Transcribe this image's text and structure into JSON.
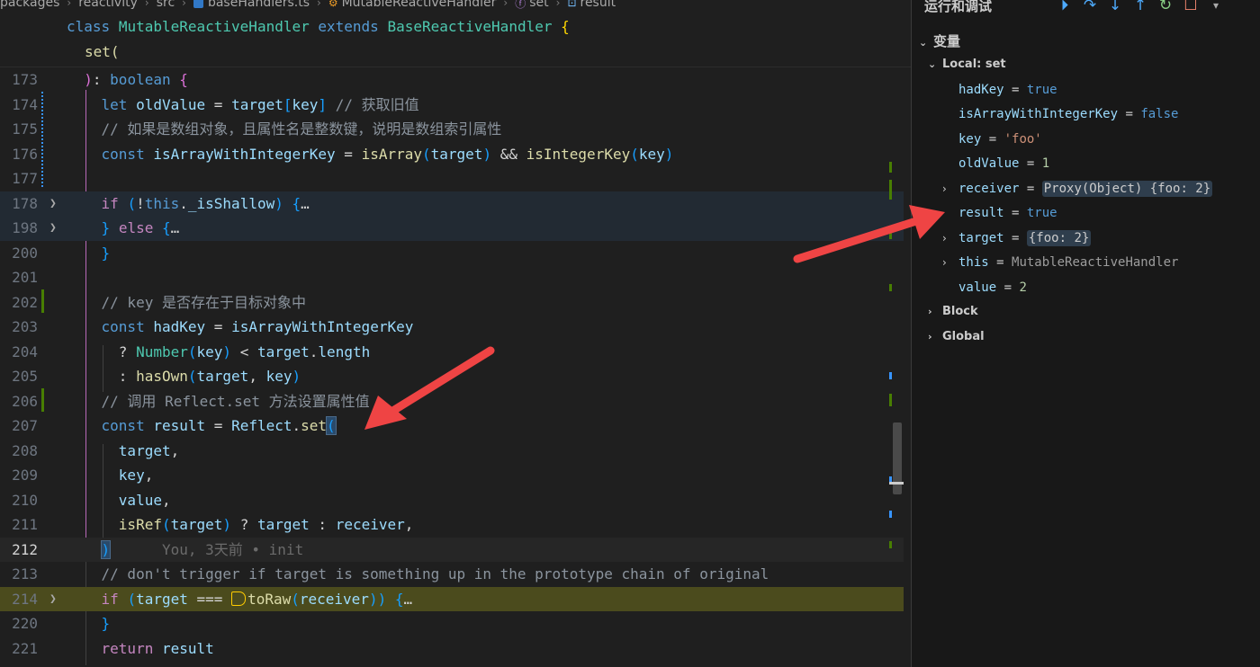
{
  "breadcrumb": [
    "packages",
    "reactivity",
    "src",
    "baseHandlers.ts",
    "MutableReactiveHandler",
    "set",
    "result"
  ],
  "sticky": {
    "class_line": [
      "class",
      "MutableReactiveHandler",
      "extends",
      "BaseReactiveHandler",
      "{"
    ],
    "set_line": "set("
  },
  "code_lines": [
    {
      "num": "173",
      "text": "): boolean {"
    },
    {
      "num": "174",
      "text": "let oldValue = target[key] // 获取旧值"
    },
    {
      "num": "175",
      "text": "// 如果是数组对象，且属性名是整数键，说明是数组索引属性"
    },
    {
      "num": "176",
      "text": "const isArrayWithIntegerKey = isArray(target) && isIntegerKey(key)"
    },
    {
      "num": "177",
      "text": ""
    },
    {
      "num": "178",
      "text": "if (!this._isShallow) {…"
    },
    {
      "num": "198",
      "text": "} else {…"
    },
    {
      "num": "200",
      "text": "}"
    },
    {
      "num": "201",
      "text": ""
    },
    {
      "num": "202",
      "text": "// key 是否存在于目标对象中"
    },
    {
      "num": "203",
      "text": "const hadKey = isArrayWithIntegerKey"
    },
    {
      "num": "204",
      "text": "? Number(key) < target.length"
    },
    {
      "num": "205",
      "text": ": hasOwn(target, key)"
    },
    {
      "num": "206",
      "text": "// 调用 Reflect.set 方法设置属性值"
    },
    {
      "num": "207",
      "text": "const result = Reflect.set("
    },
    {
      "num": "208",
      "text": "target,"
    },
    {
      "num": "209",
      "text": "key,"
    },
    {
      "num": "210",
      "text": "value,"
    },
    {
      "num": "211",
      "text": "isRef(target) ? target : receiver,"
    },
    {
      "num": "212",
      "text": ")"
    },
    {
      "num": "213",
      "text": "// don't trigger if target is something up in the prototype chain of original"
    },
    {
      "num": "214",
      "text": "if (target === toRaw(receiver)) {…"
    },
    {
      "num": "220",
      "text": "}"
    },
    {
      "num": "221",
      "text": "return result"
    }
  ],
  "blame": "You, 3天前 • init",
  "debug": {
    "title": "运行和调试",
    "variables_label": "变量",
    "scope_local": "Local: set",
    "scope_block": "Block",
    "scope_global": "Global",
    "vars": [
      {
        "name": "hadKey",
        "value": "true"
      },
      {
        "name": "isArrayWithIntegerKey",
        "value": "false"
      },
      {
        "name": "key",
        "value": "'foo'"
      },
      {
        "name": "oldValue",
        "value": "1"
      },
      {
        "name": "receiver",
        "value": "Proxy(Object) {foo: 2}"
      },
      {
        "name": "result",
        "value": "true"
      },
      {
        "name": "target",
        "value": "{foo: 2}"
      },
      {
        "name": "this",
        "value": "MutableReactiveHandler"
      },
      {
        "name": "value",
        "value": "2"
      }
    ]
  },
  "colors": {
    "accent": "#4daafc",
    "annotation_arrow": "#ef4444",
    "paused_line": "#4b4b1d"
  }
}
